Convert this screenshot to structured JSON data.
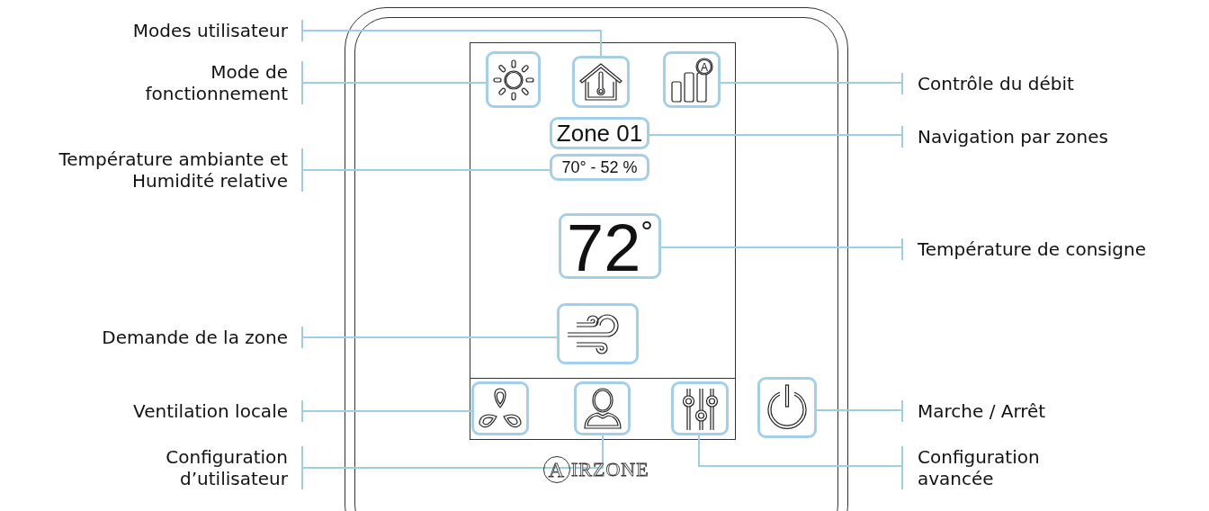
{
  "screen": {
    "flow_badge": "A",
    "zone_name": "Zone 01",
    "ambient_reading": "70° - 52 %",
    "setpoint": "72",
    "setpoint_unit": "°"
  },
  "logo": "AIRZONE",
  "callouts": [
    {
      "kind": "left",
      "lines": [
        "Modes utilisateur"
      ]
    },
    {
      "kind": "left",
      "lines": [
        "Mode de",
        "fonctionnement"
      ]
    },
    {
      "kind": "left",
      "lines": [
        "Température ambiante et",
        "Humidité relative"
      ]
    },
    {
      "kind": "left",
      "lines": [
        "Demande de la zone"
      ]
    },
    {
      "kind": "left",
      "lines": [
        "Ventilation locale"
      ]
    },
    {
      "kind": "left",
      "lines": [
        "Configuration",
        "d’utilisateur"
      ]
    },
    {
      "kind": "right",
      "lines": [
        "Contrôle du débit"
      ]
    },
    {
      "kind": "right",
      "lines": [
        "Navigation par zones"
      ]
    },
    {
      "kind": "right",
      "lines": [
        "Température de consigne"
      ]
    },
    {
      "kind": "right",
      "lines": [
        "Marche / Arrêt"
      ]
    },
    {
      "kind": "right",
      "lines": [
        "Configuration",
        "avancée"
      ]
    }
  ]
}
